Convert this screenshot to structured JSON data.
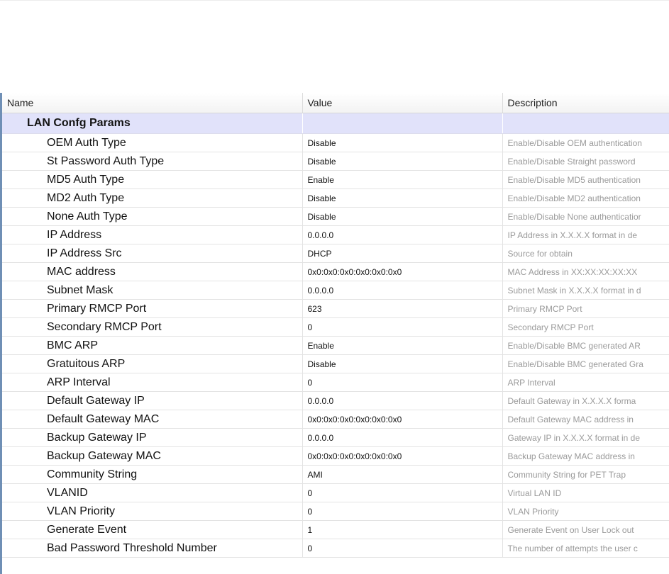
{
  "columns": {
    "name": "Name",
    "value": "Value",
    "description": "Description"
  },
  "group": {
    "label": "LAN Confg Params"
  },
  "rows": [
    {
      "name": "OEM Auth Type",
      "value": "Disable",
      "description": "Enable/Disable OEM authentication"
    },
    {
      "name": "St Password Auth Type",
      "value": "Disable",
      "description": "Enable/Disable Straight password"
    },
    {
      "name": "MD5 Auth Type",
      "value": "Enable",
      "description": "Enable/Disable MD5 authentication"
    },
    {
      "name": "MD2 Auth Type",
      "value": "Disable",
      "description": "Enable/Disable MD2 authentication"
    },
    {
      "name": "None Auth Type",
      "value": "Disable",
      "description": "Enable/Disable None authenticatior"
    },
    {
      "name": "IP Address",
      "value": "0.0.0.0",
      "description": "IP Address in X.X.X.X format in de"
    },
    {
      "name": "IP Address Src",
      "value": "DHCP",
      "description": "Source for obtain"
    },
    {
      "name": "MAC address",
      "value": "0x0:0x0:0x0:0x0:0x0:0x0",
      "description": "MAC Address in XX:XX:XX:XX:XX"
    },
    {
      "name": "Subnet Mask",
      "value": "0.0.0.0",
      "description": "Subnet Mask in X.X.X.X format in d"
    },
    {
      "name": "Primary RMCP Port",
      "value": "623",
      "description": "Primary RMCP Port"
    },
    {
      "name": "Secondary RMCP Port",
      "value": "0",
      "description": "Secondary RMCP Port"
    },
    {
      "name": "BMC ARP",
      "value": "Enable",
      "description": "Enable/Disable BMC generated AR"
    },
    {
      "name": "Gratuitous ARP",
      "value": "Disable",
      "description": "Enable/Disable BMC generated Gra"
    },
    {
      "name": "ARP Interval",
      "value": "0",
      "description": "ARP Interval"
    },
    {
      "name": "Default Gateway IP",
      "value": "0.0.0.0",
      "description": "Default Gateway in X.X.X.X forma"
    },
    {
      "name": "Default Gateway MAC",
      "value": "0x0:0x0:0x0:0x0:0x0:0x0",
      "description": "Default Gateway MAC address in"
    },
    {
      "name": "Backup Gateway IP",
      "value": "0.0.0.0",
      "description": "Gateway IP in X.X.X.X format in de"
    },
    {
      "name": "Backup Gateway MAC",
      "value": "0x0:0x0:0x0:0x0:0x0:0x0",
      "description": "Backup Gateway MAC address in"
    },
    {
      "name": "Community String",
      "value": "AMI",
      "description": "Community String for PET Trap"
    },
    {
      "name": "VLANID",
      "value": "0",
      "description": "Virtual LAN ID"
    },
    {
      "name": "VLAN Priority",
      "value": "0",
      "description": "VLAN Priority"
    },
    {
      "name": "Generate Event",
      "value": "1",
      "description": "Generate Event on User Lock out"
    },
    {
      "name": "Bad Password Threshold Number",
      "value": "0",
      "description": "The number of attempts the user c"
    }
  ]
}
